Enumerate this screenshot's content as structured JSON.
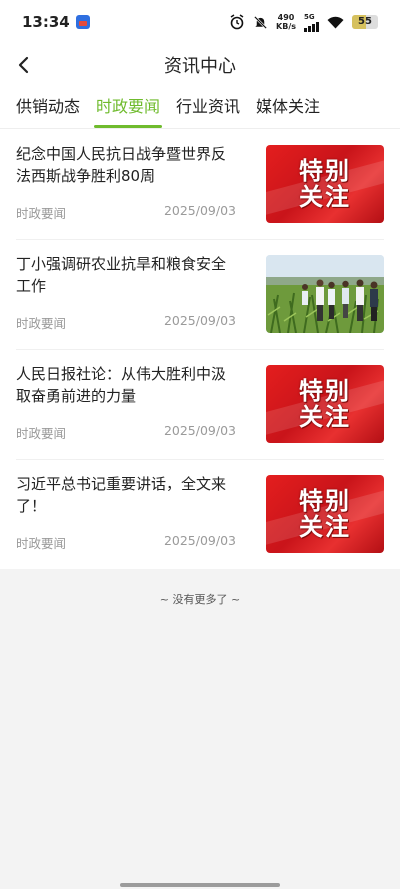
{
  "status_bar": {
    "time": "13:34",
    "net_speed_value": "490",
    "net_speed_unit": "KB/s",
    "network_type": "5G",
    "battery_level": "55"
  },
  "header": {
    "title": "资讯中心"
  },
  "tabs": [
    {
      "label": "供销动态",
      "active": false
    },
    {
      "label": "时政要闻",
      "active": true
    },
    {
      "label": "行业资讯",
      "active": false
    },
    {
      "label": "媒体关注",
      "active": false
    }
  ],
  "articles": [
    {
      "title": "纪念中国人民抗日战争暨世界反法西斯战争胜利80周",
      "category": "时政要闻",
      "date": "2025/09/03",
      "thumb": "special",
      "thumb_text": [
        "特别",
        "关注"
      ]
    },
    {
      "title": "丁小强调研农业抗旱和粮食安全工作",
      "category": "时政要闻",
      "date": "2025/09/03",
      "thumb": "photo"
    },
    {
      "title": "人民日报社论：从伟大胜利中汲取奋勇前进的力量",
      "category": "时政要闻",
      "date": "2025/09/03",
      "thumb": "special",
      "thumb_text": [
        "特别",
        "关注"
      ]
    },
    {
      "title": "习近平总书记重要讲话，全文来了！",
      "category": "时政要闻",
      "date": "2025/09/03",
      "thumb": "special",
      "thumb_text": [
        "特别",
        "关注"
      ]
    }
  ],
  "footer": {
    "end_text": "~ 没有更多了 ~"
  },
  "colors": {
    "accent": "#6fbb2d",
    "special_red": "#d3171d"
  }
}
